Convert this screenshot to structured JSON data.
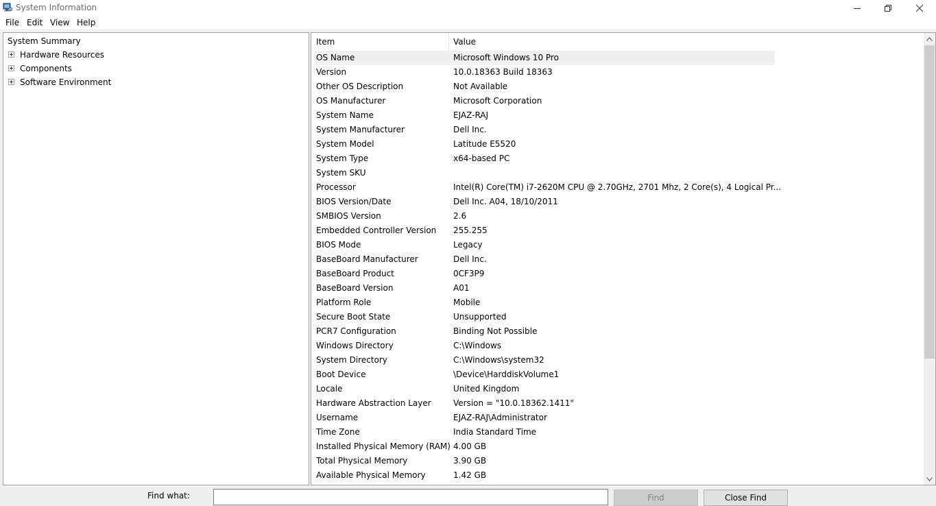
{
  "window": {
    "title": "System Information",
    "app_icon": "system-information-icon",
    "controls": [
      "minimize-icon",
      "restore-icon",
      "close-icon"
    ]
  },
  "menu": [
    "File",
    "Edit",
    "View",
    "Help"
  ],
  "tree": {
    "root": "System Summary",
    "nodes": [
      "Hardware Resources",
      "Components",
      "Software Environment"
    ]
  },
  "list": {
    "columns": {
      "item": "Item",
      "value": "Value"
    },
    "rows": [
      {
        "item": "OS Name",
        "value": "Microsoft Windows 10 Pro"
      },
      {
        "item": "Version",
        "value": "10.0.18363 Build 18363"
      },
      {
        "item": "Other OS Description",
        "value": "Not Available"
      },
      {
        "item": "OS Manufacturer",
        "value": "Microsoft Corporation"
      },
      {
        "item": "System Name",
        "value": "EJAZ-RAJ"
      },
      {
        "item": "System Manufacturer",
        "value": "Dell Inc."
      },
      {
        "item": "System Model",
        "value": "Latitude E5520"
      },
      {
        "item": "System Type",
        "value": "x64-based PC"
      },
      {
        "item": "System SKU",
        "value": ""
      },
      {
        "item": "Processor",
        "value": "Intel(R) Core(TM) i7-2620M CPU @ 2.70GHz, 2701 Mhz, 2 Core(s), 4 Logical Pr..."
      },
      {
        "item": "BIOS Version/Date",
        "value": "Dell Inc. A04, 18/10/2011"
      },
      {
        "item": "SMBIOS Version",
        "value": "2.6"
      },
      {
        "item": "Embedded Controller Version",
        "value": "255.255"
      },
      {
        "item": "BIOS Mode",
        "value": "Legacy"
      },
      {
        "item": "BaseBoard Manufacturer",
        "value": "Dell Inc."
      },
      {
        "item": "BaseBoard Product",
        "value": "0CF3P9"
      },
      {
        "item": "BaseBoard Version",
        "value": "A01"
      },
      {
        "item": "Platform Role",
        "value": "Mobile"
      },
      {
        "item": "Secure Boot State",
        "value": "Unsupported"
      },
      {
        "item": "PCR7 Configuration",
        "value": "Binding Not Possible"
      },
      {
        "item": "Windows Directory",
        "value": "C:\\Windows"
      },
      {
        "item": "System Directory",
        "value": "C:\\Windows\\system32"
      },
      {
        "item": "Boot Device",
        "value": "\\Device\\HarddiskVolume1"
      },
      {
        "item": "Locale",
        "value": "United Kingdom"
      },
      {
        "item": "Hardware Abstraction Layer",
        "value": "Version = \"10.0.18362.1411\""
      },
      {
        "item": "Username",
        "value": "EJAZ-RAJ\\Administrator"
      },
      {
        "item": "Time Zone",
        "value": "India Standard Time"
      },
      {
        "item": "Installed Physical Memory (RAM)",
        "value": "4.00 GB"
      },
      {
        "item": "Total Physical Memory",
        "value": "3.90 GB"
      },
      {
        "item": "Available Physical Memory",
        "value": "1.42 GB"
      }
    ]
  },
  "find": {
    "label": "Find what:",
    "value": "",
    "find_button": "Find",
    "close_button": "Close Find"
  }
}
